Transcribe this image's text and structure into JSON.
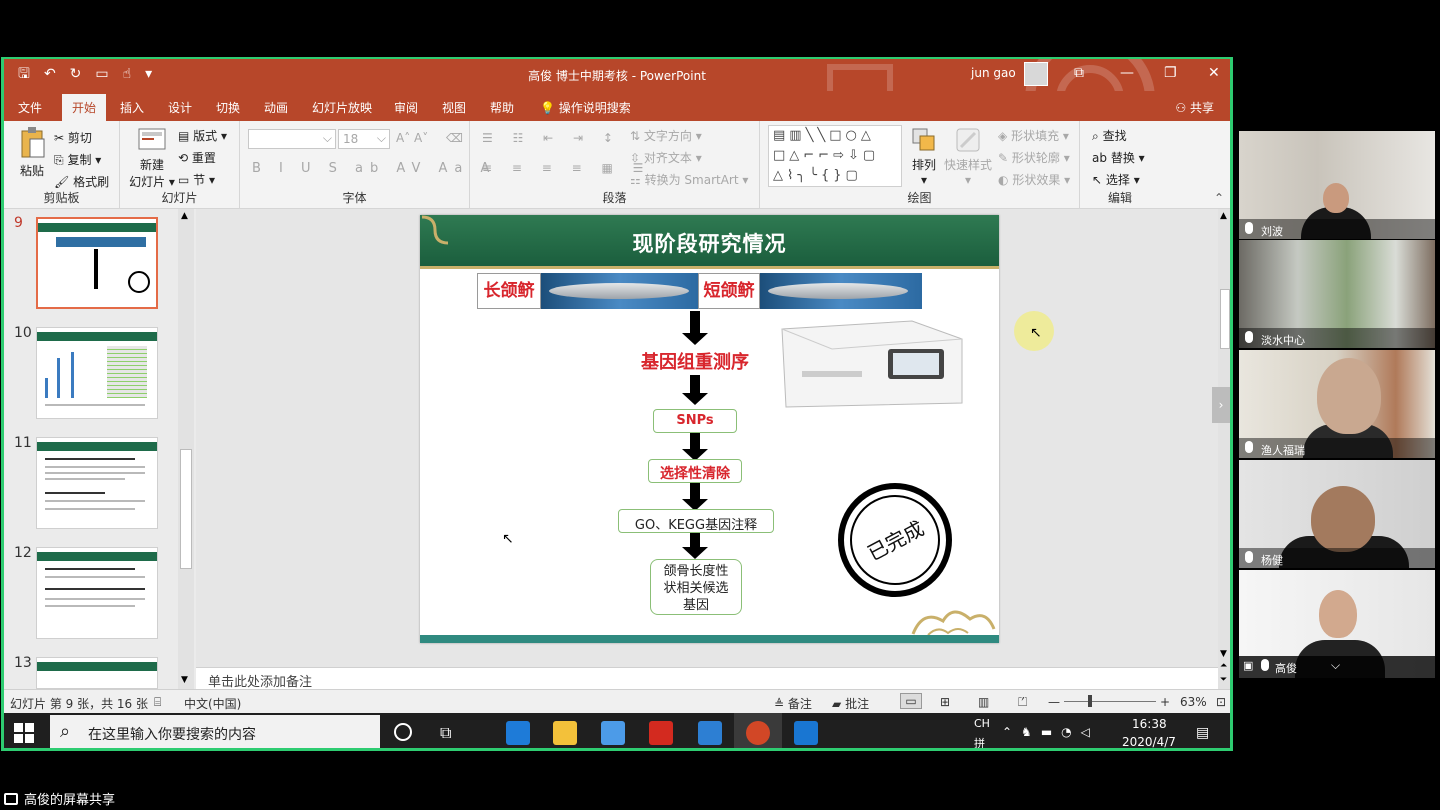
{
  "app": {
    "doc_title": "高俊  博士中期考核  -  PowerPoint",
    "user": "jun gao"
  },
  "tabs": [
    "文件",
    "开始",
    "插入",
    "设计",
    "切换",
    "动画",
    "幻灯片放映",
    "审阅",
    "视图",
    "帮助"
  ],
  "tab_search": "操作说明搜索",
  "share_label": "共享",
  "ribbon": {
    "clipboard": {
      "label": "剪贴板",
      "paste": "粘贴",
      "cut": "剪切",
      "copy": "复制",
      "format": "格式刷"
    },
    "slides": {
      "label": "幻灯片",
      "new": "新建",
      "new2": "幻灯片",
      "layout": "版式",
      "reset": "重置",
      "section": "节"
    },
    "font": {
      "label": "字体",
      "size": "18"
    },
    "paragraph": {
      "label": "段落",
      "text_dir": "文字方向",
      "align_text": "对齐文本",
      "smartart": "转换为 SmartArt"
    },
    "drawing": {
      "label": "绘图",
      "arrange": "排列",
      "quick_styles": "快速样式",
      "fill": "形状填充",
      "outline": "形状轮廓",
      "effects": "形状效果"
    },
    "editing": {
      "label": "编辑",
      "find": "查找",
      "replace": "替换",
      "select": "选择"
    }
  },
  "thumbnails": [
    {
      "num": "9",
      "active": true
    },
    {
      "num": "10",
      "active": false
    },
    {
      "num": "11",
      "active": false
    },
    {
      "num": "12",
      "active": false
    },
    {
      "num": "13",
      "active": false
    }
  ],
  "slide": {
    "title": "现阶段研究情况",
    "fish1": "长颌鲚",
    "fish2": "短颌鲚",
    "step1": "基因组重测序",
    "step2": "SNPs",
    "step3": "选择性清除",
    "step4": "GO、KEGG基因注释",
    "step5_l1": "颌骨长度性",
    "step5_l2": "状相关候选",
    "step5_l3": "基因",
    "stamp": "已完成"
  },
  "notes_placeholder": "单击此处添加备注",
  "status": {
    "slide_info": "幻灯片 第 9 张，共 16 张",
    "language": "中文(中国)",
    "notes": "备注",
    "comments": "批注",
    "zoom": "63%"
  },
  "taskbar": {
    "search_placeholder": "在这里输入你要搜索的内容",
    "ime_top": "CH",
    "ime_bottom": "拼",
    "time": "16:38",
    "date": "2020/4/7"
  },
  "participants": [
    {
      "name": "刘波"
    },
    {
      "name": "淡水中心"
    },
    {
      "name": "渔人福瑞"
    },
    {
      "name": "杨健"
    },
    {
      "name": "高俊"
    }
  ],
  "share_banner": "高俊的屏幕共享",
  "colors": {
    "ppt_accent": "#b7472a",
    "slide_header": "#1b5e3d",
    "share_border": "#2ecc71",
    "red_text": "#d8262d"
  }
}
